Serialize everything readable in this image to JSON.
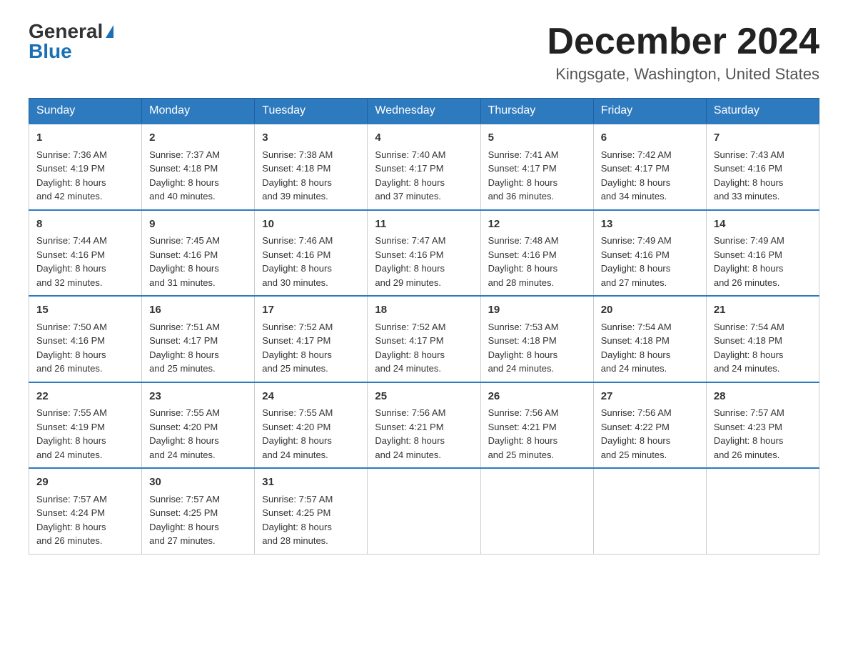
{
  "logo": {
    "part1": "General",
    "part2": "Blue"
  },
  "header": {
    "month_year": "December 2024",
    "location": "Kingsgate, Washington, United States"
  },
  "weekdays": [
    "Sunday",
    "Monday",
    "Tuesday",
    "Wednesday",
    "Thursday",
    "Friday",
    "Saturday"
  ],
  "weeks": [
    [
      {
        "day": "1",
        "sunrise": "7:36 AM",
        "sunset": "4:19 PM",
        "daylight": "8 hours and 42 minutes."
      },
      {
        "day": "2",
        "sunrise": "7:37 AM",
        "sunset": "4:18 PM",
        "daylight": "8 hours and 40 minutes."
      },
      {
        "day": "3",
        "sunrise": "7:38 AM",
        "sunset": "4:18 PM",
        "daylight": "8 hours and 39 minutes."
      },
      {
        "day": "4",
        "sunrise": "7:40 AM",
        "sunset": "4:17 PM",
        "daylight": "8 hours and 37 minutes."
      },
      {
        "day": "5",
        "sunrise": "7:41 AM",
        "sunset": "4:17 PM",
        "daylight": "8 hours and 36 minutes."
      },
      {
        "day": "6",
        "sunrise": "7:42 AM",
        "sunset": "4:17 PM",
        "daylight": "8 hours and 34 minutes."
      },
      {
        "day": "7",
        "sunrise": "7:43 AM",
        "sunset": "4:16 PM",
        "daylight": "8 hours and 33 minutes."
      }
    ],
    [
      {
        "day": "8",
        "sunrise": "7:44 AM",
        "sunset": "4:16 PM",
        "daylight": "8 hours and 32 minutes."
      },
      {
        "day": "9",
        "sunrise": "7:45 AM",
        "sunset": "4:16 PM",
        "daylight": "8 hours and 31 minutes."
      },
      {
        "day": "10",
        "sunrise": "7:46 AM",
        "sunset": "4:16 PM",
        "daylight": "8 hours and 30 minutes."
      },
      {
        "day": "11",
        "sunrise": "7:47 AM",
        "sunset": "4:16 PM",
        "daylight": "8 hours and 29 minutes."
      },
      {
        "day": "12",
        "sunrise": "7:48 AM",
        "sunset": "4:16 PM",
        "daylight": "8 hours and 28 minutes."
      },
      {
        "day": "13",
        "sunrise": "7:49 AM",
        "sunset": "4:16 PM",
        "daylight": "8 hours and 27 minutes."
      },
      {
        "day": "14",
        "sunrise": "7:49 AM",
        "sunset": "4:16 PM",
        "daylight": "8 hours and 26 minutes."
      }
    ],
    [
      {
        "day": "15",
        "sunrise": "7:50 AM",
        "sunset": "4:16 PM",
        "daylight": "8 hours and 26 minutes."
      },
      {
        "day": "16",
        "sunrise": "7:51 AM",
        "sunset": "4:17 PM",
        "daylight": "8 hours and 25 minutes."
      },
      {
        "day": "17",
        "sunrise": "7:52 AM",
        "sunset": "4:17 PM",
        "daylight": "8 hours and 25 minutes."
      },
      {
        "day": "18",
        "sunrise": "7:52 AM",
        "sunset": "4:17 PM",
        "daylight": "8 hours and 24 minutes."
      },
      {
        "day": "19",
        "sunrise": "7:53 AM",
        "sunset": "4:18 PM",
        "daylight": "8 hours and 24 minutes."
      },
      {
        "day": "20",
        "sunrise": "7:54 AM",
        "sunset": "4:18 PM",
        "daylight": "8 hours and 24 minutes."
      },
      {
        "day": "21",
        "sunrise": "7:54 AM",
        "sunset": "4:18 PM",
        "daylight": "8 hours and 24 minutes."
      }
    ],
    [
      {
        "day": "22",
        "sunrise": "7:55 AM",
        "sunset": "4:19 PM",
        "daylight": "8 hours and 24 minutes."
      },
      {
        "day": "23",
        "sunrise": "7:55 AM",
        "sunset": "4:20 PM",
        "daylight": "8 hours and 24 minutes."
      },
      {
        "day": "24",
        "sunrise": "7:55 AM",
        "sunset": "4:20 PM",
        "daylight": "8 hours and 24 minutes."
      },
      {
        "day": "25",
        "sunrise": "7:56 AM",
        "sunset": "4:21 PM",
        "daylight": "8 hours and 24 minutes."
      },
      {
        "day": "26",
        "sunrise": "7:56 AM",
        "sunset": "4:21 PM",
        "daylight": "8 hours and 25 minutes."
      },
      {
        "day": "27",
        "sunrise": "7:56 AM",
        "sunset": "4:22 PM",
        "daylight": "8 hours and 25 minutes."
      },
      {
        "day": "28",
        "sunrise": "7:57 AM",
        "sunset": "4:23 PM",
        "daylight": "8 hours and 26 minutes."
      }
    ],
    [
      {
        "day": "29",
        "sunrise": "7:57 AM",
        "sunset": "4:24 PM",
        "daylight": "8 hours and 26 minutes."
      },
      {
        "day": "30",
        "sunrise": "7:57 AM",
        "sunset": "4:25 PM",
        "daylight": "8 hours and 27 minutes."
      },
      {
        "day": "31",
        "sunrise": "7:57 AM",
        "sunset": "4:25 PM",
        "daylight": "8 hours and 28 minutes."
      },
      null,
      null,
      null,
      null
    ]
  ],
  "labels": {
    "sunrise": "Sunrise:",
    "sunset": "Sunset:",
    "daylight": "Daylight:"
  }
}
